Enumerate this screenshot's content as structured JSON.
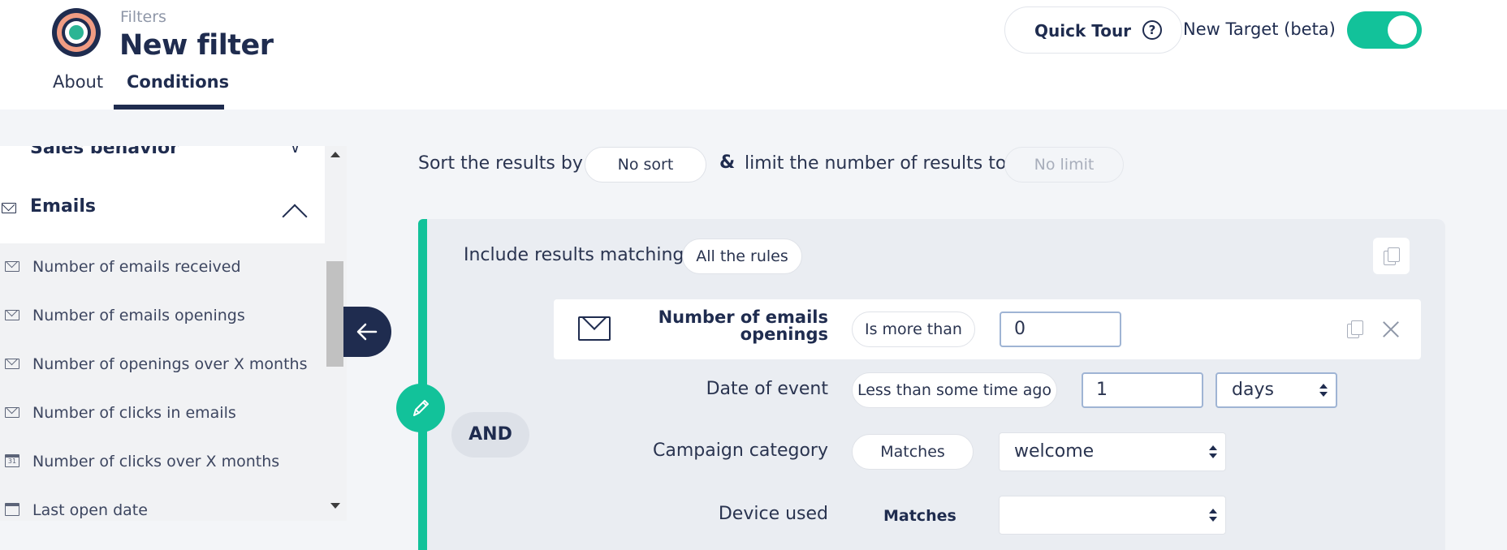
{
  "header": {
    "breadcrumb": "Filters",
    "title": "New filter",
    "tabs": [
      "About",
      "Conditions"
    ],
    "active_tab": "Conditions",
    "quick_tour": "Quick Tour",
    "help_icon": "?",
    "target_label": "New Target (beta)",
    "target_toggle_on": true
  },
  "sidebar": {
    "categories": [
      {
        "label": "Sales behavior",
        "expanded": false
      },
      {
        "label": "Emails",
        "expanded": true
      }
    ],
    "items": [
      {
        "label": "Number of emails received",
        "icon": "mail-icon"
      },
      {
        "label": "Number of emails openings",
        "icon": "mail-icon"
      },
      {
        "label": "Number of openings over X months",
        "icon": "mail-icon"
      },
      {
        "label": "Number of clicks in emails",
        "icon": "mail-icon"
      },
      {
        "label": "Number of clicks over X months",
        "icon": "calendar-icon",
        "icon_text": "31"
      },
      {
        "label": "Last open date",
        "icon": "calendar-icon"
      }
    ]
  },
  "sort": {
    "label": "Sort the results by",
    "value": "No sort",
    "amp": "&",
    "limit_label": "limit the number of results to",
    "limit_value": "No limit"
  },
  "rules": {
    "include_label": "Include results matching",
    "match_value": "All the rules",
    "operator": "AND",
    "rule": {
      "name": "Number of emails openings",
      "condition": "Is more than",
      "value": "0"
    },
    "rows": [
      {
        "label": "Date of event",
        "condition": "Less than some time ago",
        "value": "1",
        "unit": "days"
      },
      {
        "label": "Campaign category",
        "condition": "Matches",
        "value": "welcome"
      },
      {
        "label": "Device used",
        "condition": "Matches",
        "value": ""
      }
    ]
  },
  "colors": {
    "accent": "#12c29a",
    "navy": "#1f2c4f",
    "background": "#f3f5f8"
  }
}
